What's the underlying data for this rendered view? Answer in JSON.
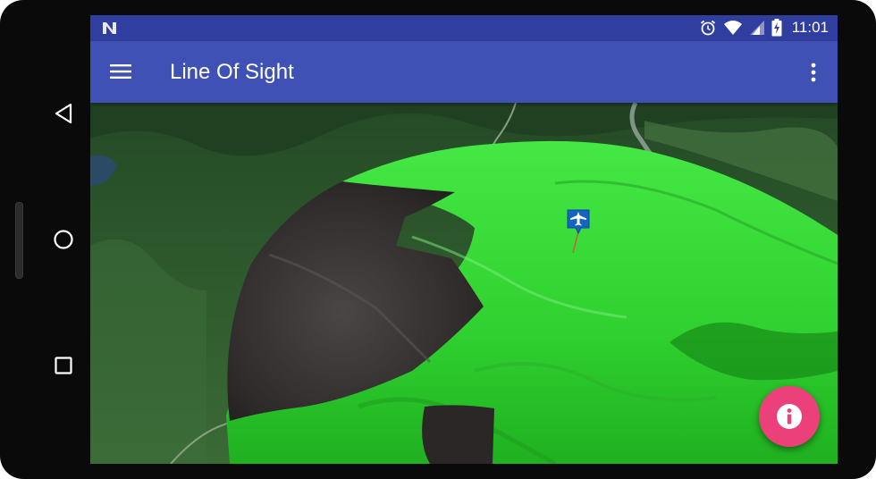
{
  "status_bar": {
    "time": "11:01",
    "icons": [
      "notification-n-icon",
      "alarm-icon",
      "wifi-icon",
      "cell-signal-icon",
      "battery-charging-icon"
    ]
  },
  "app_bar": {
    "title": "Line Of Sight",
    "menu_icon": "hamburger-menu-icon",
    "overflow_icon": "more-vert-icon"
  },
  "map": {
    "observer_marker_icon": "airplane-icon",
    "visible_color": "#3ddc3d",
    "not_visible_color": "#2e2b2b"
  },
  "fab": {
    "icon": "info-icon",
    "color": "#ec407a"
  },
  "system_nav": {
    "icons": [
      "back-icon",
      "home-icon",
      "recents-icon"
    ]
  },
  "colors": {
    "primary": "#3f51b5",
    "primary_dark": "#303f9f",
    "accent": "#ec407a"
  }
}
